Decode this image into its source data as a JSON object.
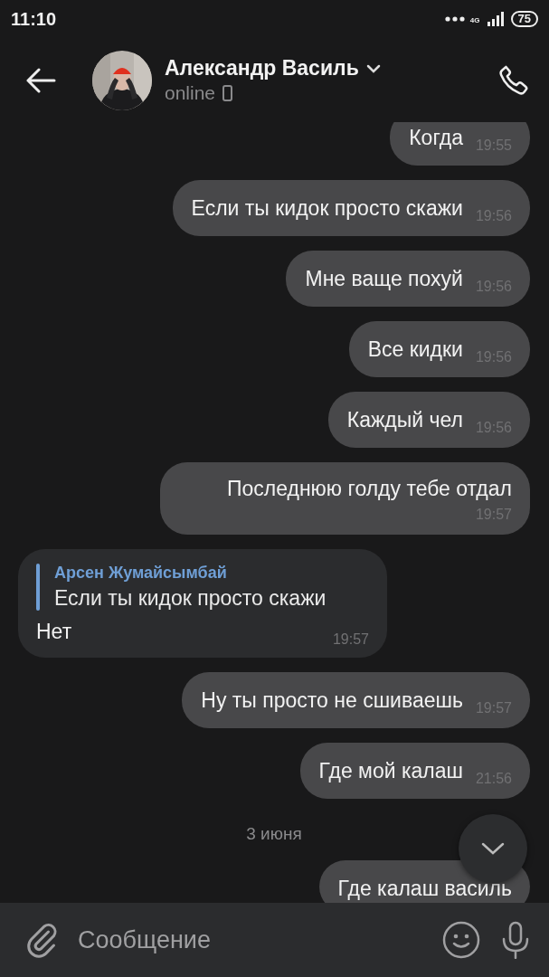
{
  "status_bar": {
    "time": "11:10",
    "network": "4G",
    "battery": "75"
  },
  "header": {
    "name": "Александр Василь",
    "status": "online"
  },
  "messages": [
    {
      "kind": "outgoing",
      "text": "Когда",
      "time": "19:55"
    },
    {
      "kind": "outgoing",
      "text": "Если ты кидок просто скажи",
      "time": "19:56"
    },
    {
      "kind": "outgoing",
      "text": "Мне ваще похуй",
      "time": "19:56"
    },
    {
      "kind": "outgoing",
      "text": "Все кидки",
      "time": "19:56"
    },
    {
      "kind": "outgoing",
      "text": "Каждый чел",
      "time": "19:56"
    },
    {
      "kind": "outgoing",
      "text": "Последнюю голду тебе отдал",
      "time": "19:57"
    },
    {
      "kind": "incoming",
      "reply": {
        "author": "Арсен Жумайсымбай",
        "text": "Если ты кидок просто скажи"
      },
      "text": "Нет",
      "time": "19:57"
    },
    {
      "kind": "outgoing",
      "text": "Ну ты просто не сшиваешь",
      "time": "19:57"
    },
    {
      "kind": "outgoing",
      "text": "Где мой калаш",
      "time": "21:56"
    },
    {
      "kind": "date",
      "text": "3 июня"
    },
    {
      "kind": "outgoing",
      "text": "Где калаш василь"
    }
  ],
  "composer": {
    "placeholder": "Сообщение"
  }
}
